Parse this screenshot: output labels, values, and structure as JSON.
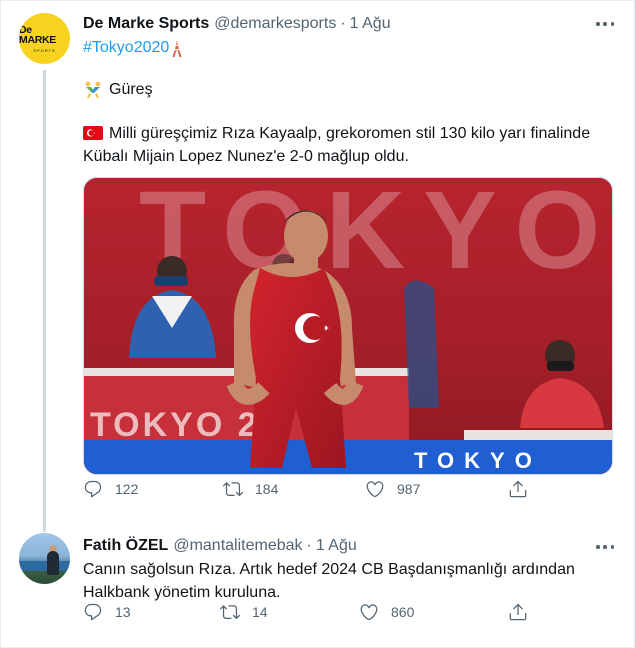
{
  "tweet1": {
    "author_name": "De Marke Sports",
    "handle": "@demarkesports",
    "separator": "·",
    "date": "1 Ağu",
    "avatar_logo_main": "De MARKE",
    "avatar_logo_sub": "SPORTS",
    "hashtag": "#Tokyo2020",
    "hashtag_emoji": "tokyo-tower-icon",
    "sport_emoji": "wrestling-icon",
    "sport": "Güreş",
    "flag_emoji": "turkey-flag-icon",
    "text": "Milli güreşçimiz Rıza Kayaalp, grekoromen stil 130 kilo yarı finalinde Kübalı Mijain Lopez Nunez'e 2-0 mağlup oldu.",
    "media": {
      "backdrop_text": "TOKYO",
      "board_text": "TOKYO 20",
      "floor_text": "TOKYO",
      "accent": "#a8202a"
    },
    "counts": {
      "replies": "122",
      "retweets": "184",
      "likes": "987"
    }
  },
  "tweet2": {
    "author_name": "Fatih ÖZEL",
    "handle": "@mantalitemebak",
    "separator": "·",
    "date": "1 Ağu",
    "text": "Canın sağolsun Rıza. Artık hedef 2024 CB Başdanışmanlığı ardından Halkbank yönetim kuruluna.",
    "counts": {
      "replies": "13",
      "retweets": "14",
      "likes": "860"
    }
  },
  "colors": {
    "link": "#1d9bf0",
    "muted": "#536471",
    "text": "#0f1419",
    "border": "#cfd9de"
  }
}
